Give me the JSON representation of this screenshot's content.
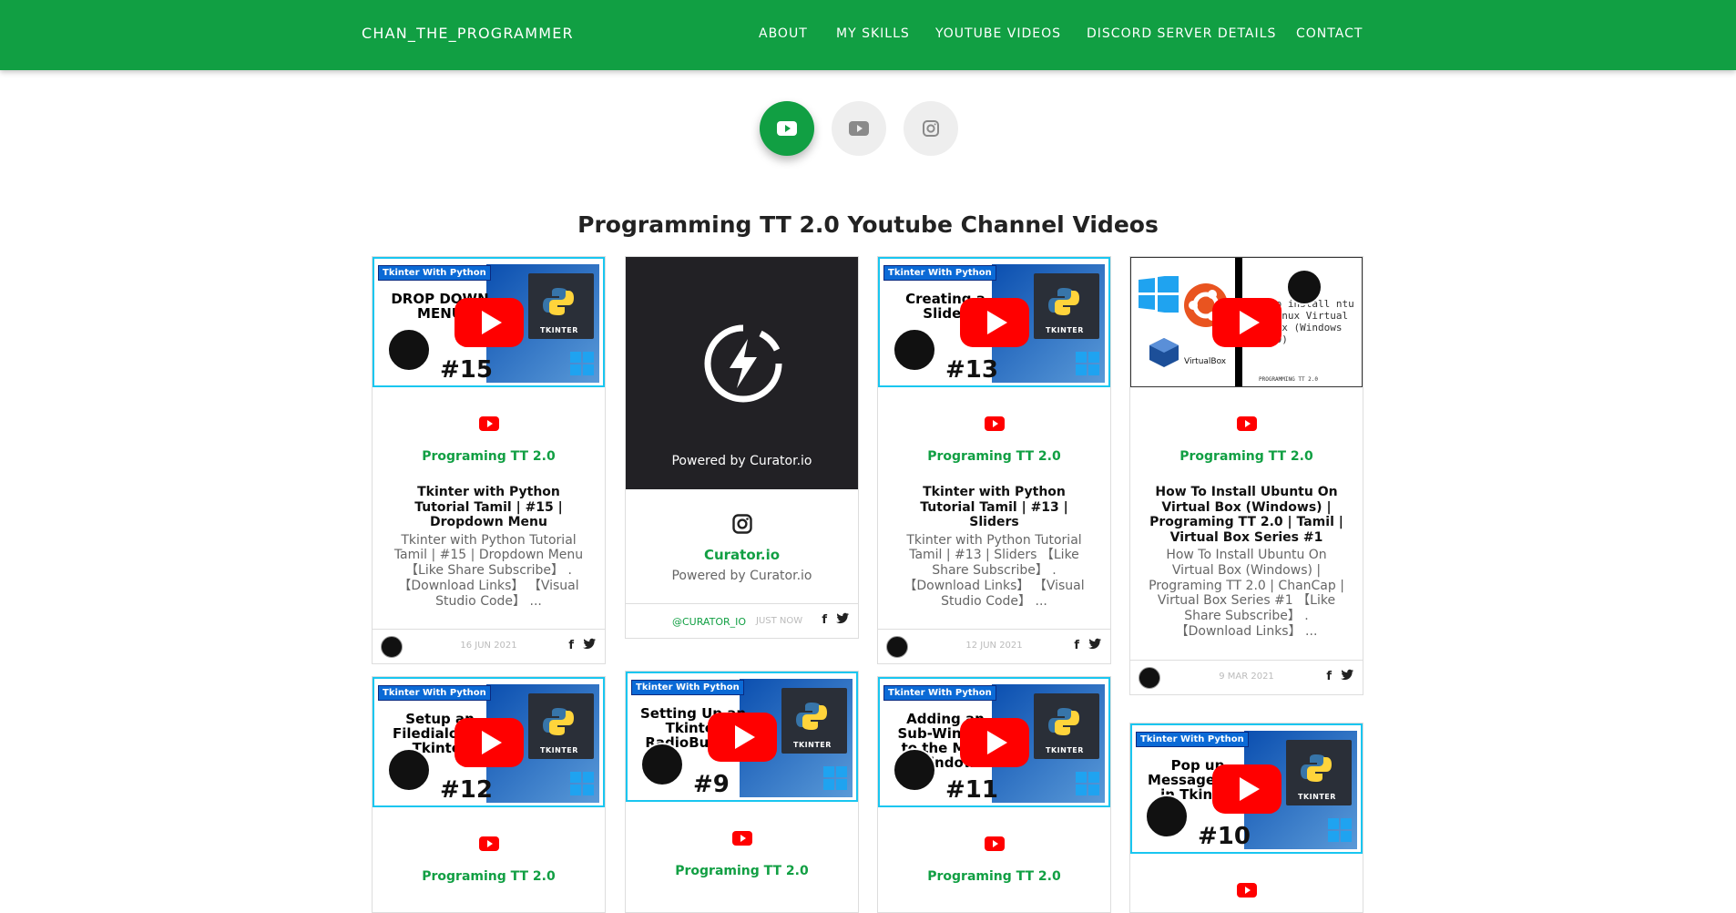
{
  "nav": {
    "brand": "CHAN_THE_PROGRAMMER",
    "items": [
      "ABOUT",
      "MY SKILLS",
      "YOUTUBE VIDEOS",
      "DISCORD SERVER DETAILS",
      "CONTACT"
    ]
  },
  "page_title": "Programming TT 2.0 Youtube Channel Videos",
  "cards": [
    {
      "tag": "Tkinter With Python",
      "thumb_text": "DROP DOWN MENU",
      "thumb_num": "#15",
      "channel": "Programing TT 2.0",
      "title": "Tkinter with Python Tutorial Tamil | #15 | Dropdown Menu",
      "desc": "Tkinter with Python Tutorial Tamil | #15 | Dropdown Menu 【Like Share Subscribe】 . 【Download Links】 【Visual Studio Code】 ...",
      "date": "16 JUN 2021"
    },
    {
      "powered": "Powered by Curator.io",
      "name": "Curator.io",
      "sub": "Powered by Curator.io",
      "handle": "@CURATOR_IO",
      "time": "JUST NOW"
    },
    {
      "tag": "Tkinter With Python",
      "thumb_text": "Creating a Slider",
      "thumb_num": "#13",
      "channel": "Programing TT 2.0",
      "title": "Tkinter with Python Tutorial Tamil | #13 | Sliders",
      "desc": "Tkinter with Python Tutorial Tamil | #13 | Sliders 【Like Share Subscribe】 . 【Download Links】 【Visual Studio Code】 ...",
      "date": "12 JUN 2021"
    },
    {
      "thumb_text": "to install ntu Linux Virtual Box (Windows 10)",
      "thumb_brand": "PROGRAMMING TT 2.0",
      "vbox_label": "VirtualBox",
      "channel": "Programing TT 2.0",
      "title": "How To Install Ubuntu On Virtual Box (Windows) | Programing TT 2.0 | Tamil | Virtual Box Series #1",
      "desc": "How To Install Ubuntu On Virtual Box (Windows) | Programing TT 2.0 | ChanCap | Virtual Box Series #1 【Like Share Subscribe】 . 【Download Links】 ...",
      "date": "9 MAR 2021"
    },
    {
      "tag": "Tkinter With Python",
      "thumb_text": "Setup an Filedialog in Tkinter",
      "thumb_num": "#12",
      "channel": "Programing TT 2.0"
    },
    {
      "tag": "Tkinter With Python",
      "thumb_text": "Setting Up an Tkinter RadioButton",
      "thumb_num": "#9",
      "channel": "Programing TT 2.0"
    },
    {
      "tag": "Tkinter With Python",
      "thumb_text": "Adding an Sub-Window to the Main Window",
      "thumb_num": "#11",
      "channel": "Programing TT 2.0"
    },
    {
      "tag": "Tkinter With Python",
      "thumb_text": "Pop up Message box in Tkinter",
      "thumb_num": "#10"
    }
  ],
  "thumb_common": {
    "tkinter_label": "TKINTER"
  },
  "colors": {
    "accent": "#119f43",
    "youtube": "#ff0000",
    "thumb_border": "#19c6f0"
  }
}
